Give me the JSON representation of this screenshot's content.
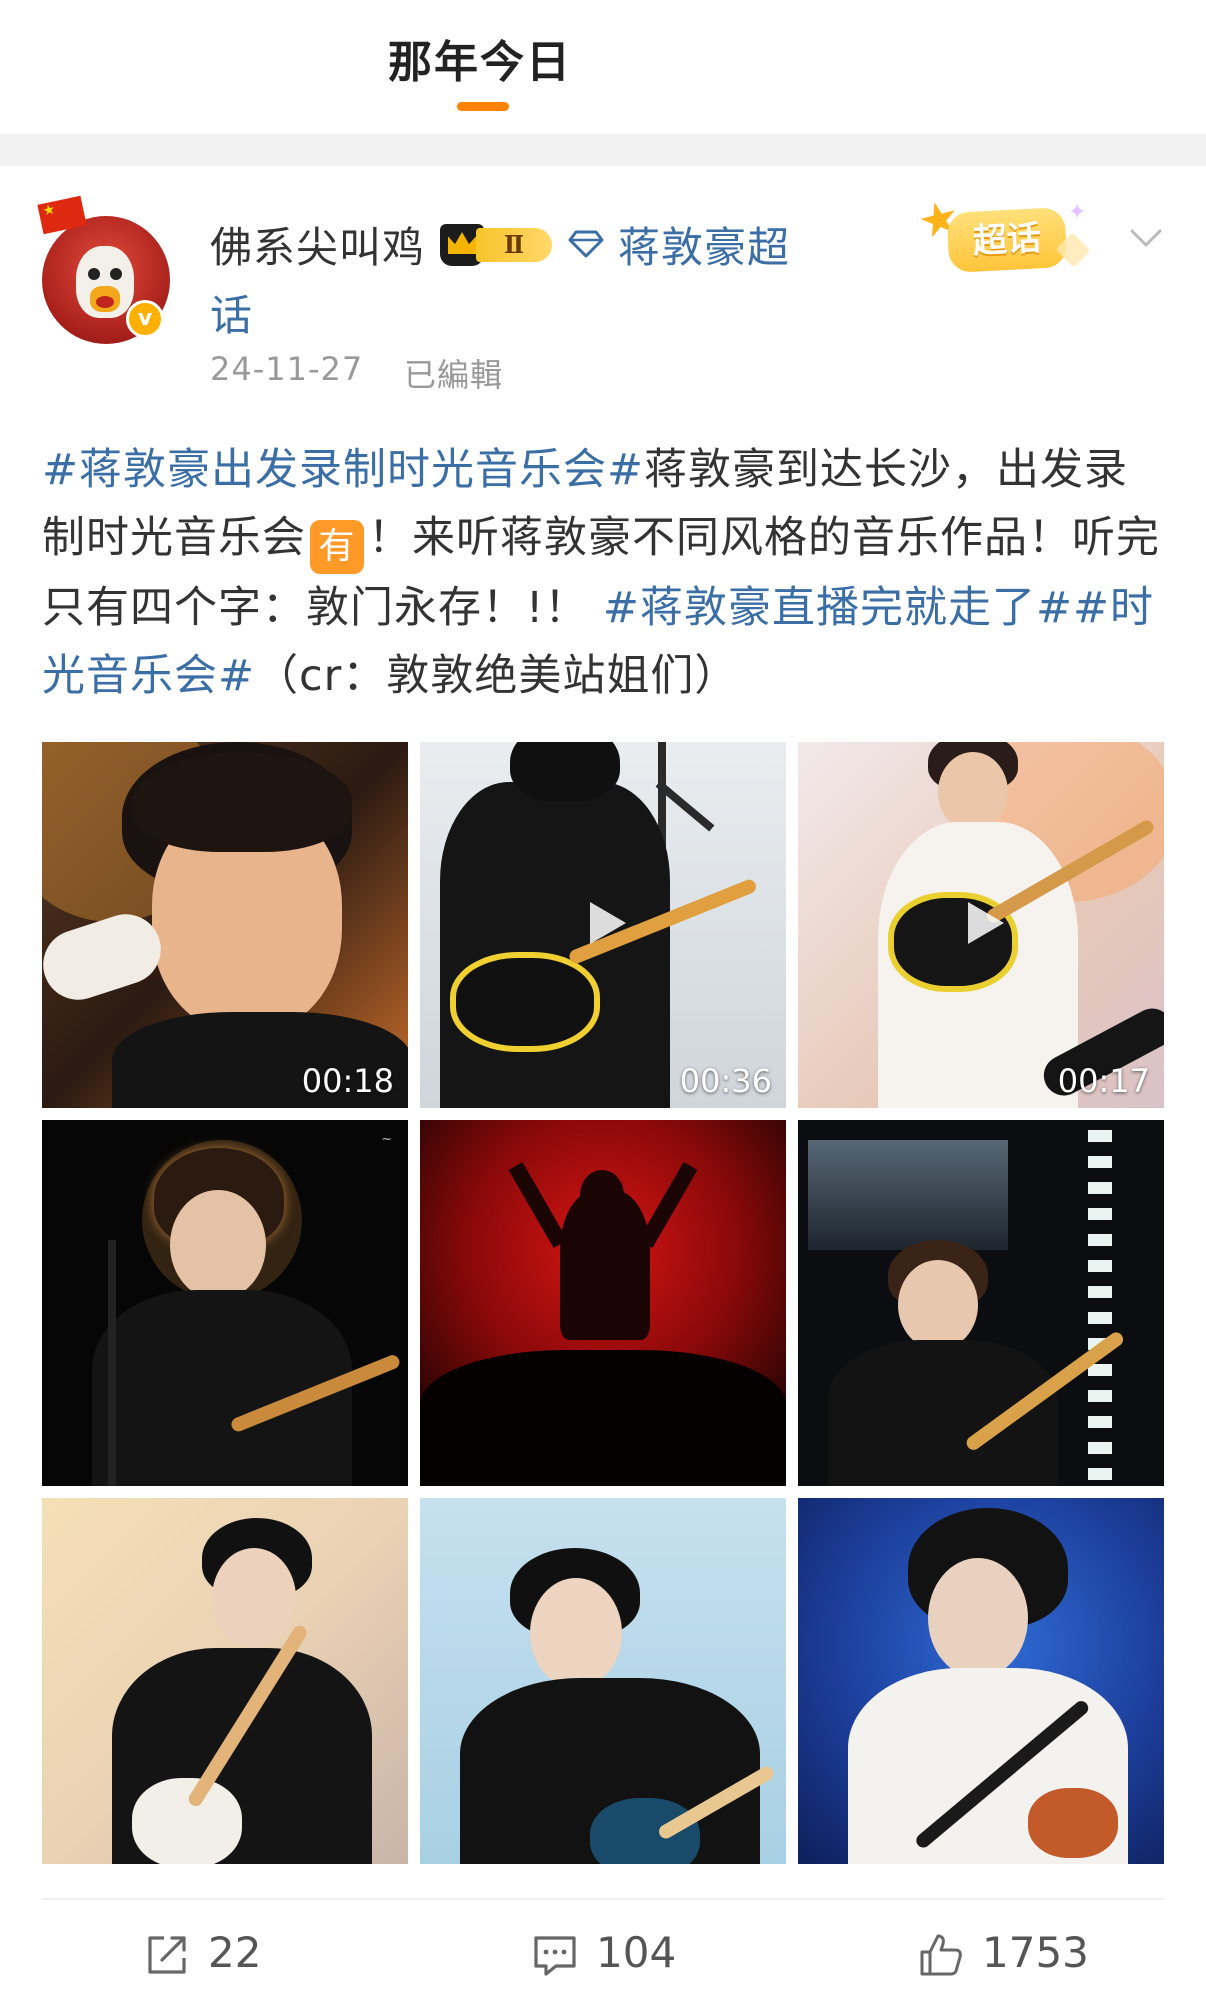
{
  "header": {
    "tab_label": "那年今日",
    "accent_color": "#ff8200"
  },
  "author": {
    "name": "佛系尖叫鸡",
    "level_label": "Ⅱ",
    "verified_badge": "v",
    "avatar_icon": "chicken-avatar",
    "topic_icon": "diamond-icon",
    "topic_line1": "蒋敦豪超",
    "topic_line2": "话",
    "date": "24-11-27",
    "edited": "已編輯",
    "chaohua_label": "超话"
  },
  "post": {
    "seg1": "#蒋敦豪出发录制时光音乐会#",
    "seg2": "蒋敦豪到达长沙，出发录制时光音乐会",
    "you_badge": "有",
    "seg3": "！来听蒋敦豪不同风格的音乐作品！听完只有四个字：敦门永存！!！",
    "seg4": "#蒋敦豪直播完就走了#",
    "seg5": "#时光音乐会#",
    "seg6": "（cr：敦敦绝美站姐们）"
  },
  "media": [
    {
      "type": "video",
      "duration": "00:18"
    },
    {
      "type": "video",
      "duration": "00:36"
    },
    {
      "type": "video",
      "duration": "00:17"
    },
    {
      "type": "image"
    },
    {
      "type": "image"
    },
    {
      "type": "image"
    },
    {
      "type": "image"
    },
    {
      "type": "image"
    },
    {
      "type": "image"
    }
  ],
  "actions": {
    "repost_count": "22",
    "comment_count": "104",
    "like_count": "1753"
  },
  "colors": {
    "link": "#3a6ea5",
    "meta": "#999999",
    "text": "#333333"
  }
}
